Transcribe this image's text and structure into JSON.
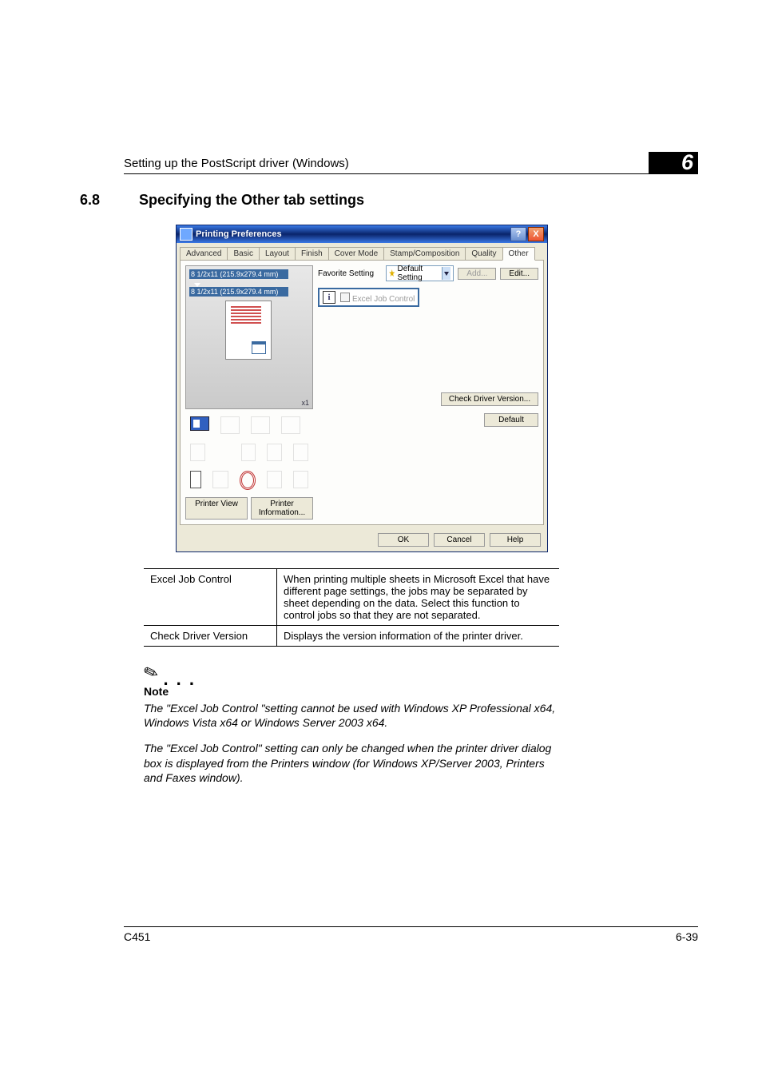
{
  "header": {
    "setup_text": "Setting up the PostScript driver (Windows)",
    "chapter": "6"
  },
  "section": {
    "num": "6.8",
    "title": "Specifying the Other tab settings"
  },
  "win": {
    "title": "Printing Preferences",
    "help_btn": "?",
    "close_btn": "X",
    "tabs": {
      "advanced": "Advanced",
      "basic": "Basic",
      "layout": "Layout",
      "finish": "Finish",
      "cover": "Cover Mode",
      "stamp": "Stamp/Composition",
      "quality": "Quality",
      "other": "Other"
    },
    "preview": {
      "size1": "8 1/2x11 (215.9x279.4 mm)",
      "size2": "8 1/2x11 (215.9x279.4 mm)",
      "x1": "x1"
    },
    "printer_view": "Printer View",
    "printer_info": "Printer Information...",
    "fav_label": "Favorite Setting",
    "fav_value": "Default Setting",
    "add": "Add...",
    "edit": "Edit...",
    "excel": "Excel Job Control",
    "check_ver": "Check Driver Version...",
    "default": "Default",
    "ok": "OK",
    "cancel": "Cancel",
    "helpb": "Help"
  },
  "table": {
    "r1": {
      "label": "Excel Job Control",
      "desc": "When printing multiple sheets in Microsoft Excel that have different page settings, the jobs may be separated by sheet depending on the data. Select this function to control jobs so that they are not separated."
    },
    "r2": {
      "label": "Check Driver Version",
      "desc": "Displays the version information of the printer driver."
    }
  },
  "note": {
    "label": "Note",
    "p1": "The \"Excel Job Control \"setting cannot be used with Windows XP Professional x64, Windows Vista x64 or Windows Server 2003 x64.",
    "p2": "The \"Excel Job Control\" setting can only be changed when the printer driver dialog box is displayed from the Printers window (for Windows XP/Server 2003, Printers and Faxes window)."
  },
  "footer": {
    "left": "C451",
    "right": "6-39"
  }
}
